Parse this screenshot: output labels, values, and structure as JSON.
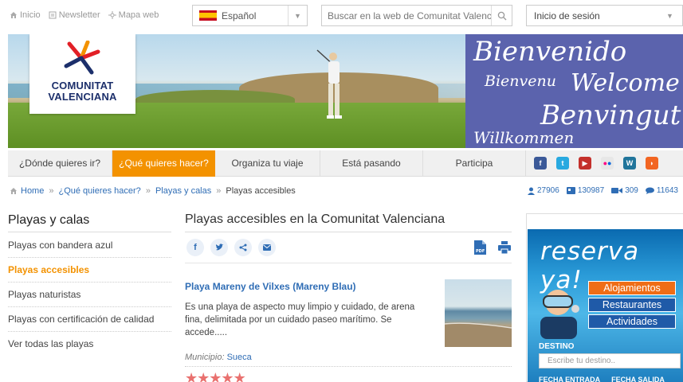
{
  "top": {
    "links": [
      "Inicio",
      "Newsletter",
      "Mapa web"
    ],
    "language": "Español",
    "search_placeholder": "Buscar en la web de Comunitat Valenciana",
    "login": "Inicio de sesión"
  },
  "banner": {
    "logo_line1": "COMUNITAT",
    "logo_line2": "VALENCIANA",
    "greetings": [
      "Bienvenido",
      "Bienvenu",
      "Welcome",
      "Benvingut",
      "Willkommen"
    ]
  },
  "nav": {
    "items": [
      "¿Dónde quieres ir?",
      "¿Qué quieres hacer?",
      "Organiza tu viaje",
      "Está pasando",
      "Participa"
    ],
    "active_index": 1,
    "social": [
      "facebook-icon",
      "twitter-icon",
      "youtube-icon",
      "flickr-icon",
      "wordpress-icon",
      "rss-icon"
    ]
  },
  "breadcrumb": [
    "Home",
    "¿Qué quieres hacer?",
    "Playas y calas",
    "Playas accesibles"
  ],
  "stats": [
    "27906",
    "130987",
    "309",
    "11643"
  ],
  "sidebar": {
    "title": "Playas y calas",
    "items": [
      "Playas con bandera azul",
      "Playas accesibles",
      "Playas naturistas",
      "Playas con certificación de calidad",
      "Ver todas las playas"
    ],
    "active_index": 1
  },
  "content": {
    "title": "Playas accesibles en la Comunitat Valenciana",
    "beach": {
      "name": "Playa Mareny de Vilxes (Mareny Blau)",
      "description": "Es una playa de aspecto muy limpio y cuidado, de arena fina, delimitada por un cuidado paseo marítimo. Se accede.....",
      "municipio_label": "Municipio:",
      "municipio": "Sueca",
      "rating": 5
    }
  },
  "ad": {
    "title": "reserva ya!",
    "buttons": [
      "Alojamientos",
      "Restaurantes",
      "Actividades"
    ],
    "destino_label": "DESTINO",
    "destino_placeholder": "Escribe tu destino..",
    "fecha_entrada": "FECHA ENTRADA",
    "fecha_salida": "FECHA SALIDA"
  },
  "colors": {
    "accent": "#f39200",
    "link": "#2f6db5",
    "welcome_bg": "#5b63ad"
  }
}
